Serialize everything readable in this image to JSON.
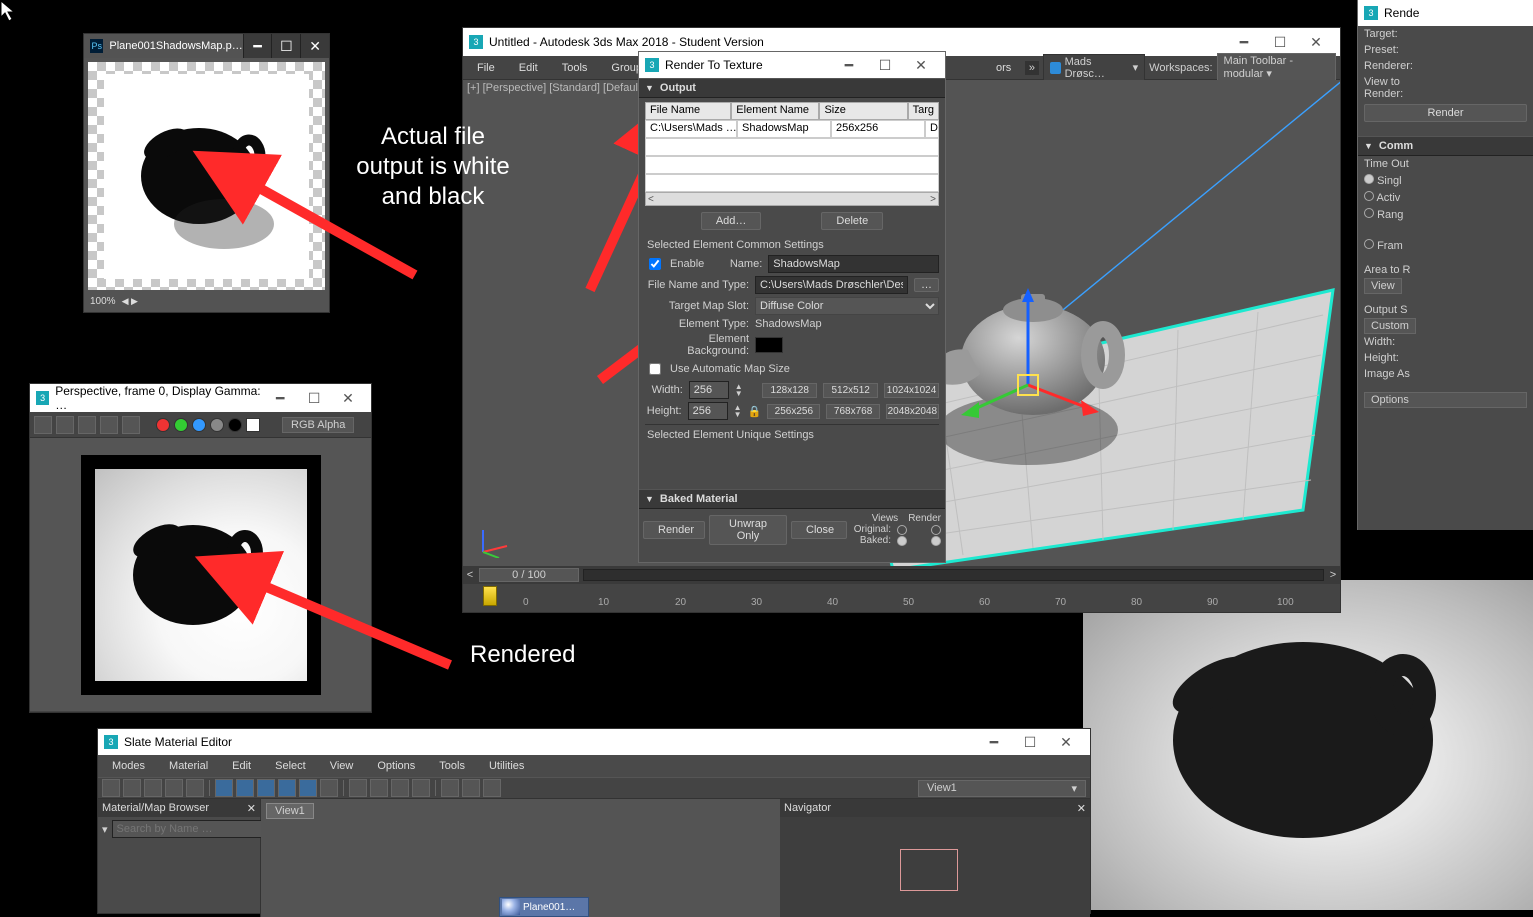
{
  "annotation": {
    "top": "Actual file\noutput is white\nand black",
    "bottom": "Rendered"
  },
  "photoshop": {
    "title": "Plane001ShadowsMap.p…",
    "zoom": "100%"
  },
  "framebuffer": {
    "title": "Perspective, frame 0, Display Gamma: …",
    "channel": "RGB Alpha"
  },
  "max": {
    "title": "Untitled - Autodesk 3ds Max 2018 - Student Version",
    "menu": [
      "File",
      "Edit",
      "Tools",
      "Group"
    ],
    "overflow_item": "ors",
    "user": "Mads Drøsc…",
    "workspaces_label": "Workspaces:",
    "workspace": "Main Toolbar - modular",
    "vp_label": "[+] [Perspective] [Standard] [Defaul",
    "frames": "0 / 100",
    "ticks": [
      "0",
      "10",
      "20",
      "30",
      "40",
      "50",
      "60",
      "70",
      "80",
      "90",
      "100"
    ]
  },
  "rtt": {
    "title": "Render To Texture",
    "output": "Output",
    "cols": {
      "fn": "File Name",
      "en": "Element Name",
      "sz": "Size",
      "tg": "Targ"
    },
    "row": {
      "fn": "C:\\Users\\Mads …",
      "en": "ShadowsMap",
      "sz": "256x256",
      "tg": "Diffu"
    },
    "add": "Add…",
    "delete": "Delete",
    "secs": "Selected Element Common Settings",
    "enable": "Enable",
    "name_lbl": "Name:",
    "name_val": "ShadowsMap",
    "file_lbl": "File Name and Type:",
    "file_val": "C:\\Users\\Mads Drøschler\\Desktop\\p",
    "slot_lbl": "Target Map Slot:",
    "slot_val": "Diffuse Color",
    "etype_lbl": "Element Type:",
    "etype_val": "ShadowsMap",
    "bg_lbl": "Element Background:",
    "auto": "Use Automatic Map Size",
    "width_lbl": "Width:",
    "width_val": "256",
    "height_lbl": "Height:",
    "height_val": "256",
    "w_btns": [
      "128x128",
      "512x512",
      "1024x1024"
    ],
    "h_btns": [
      "256x256",
      "768x768",
      "2048x2048"
    ],
    "seus": "Selected Element Unique Settings",
    "baked": "Baked Material",
    "render": "Render",
    "unwrap": "Unwrap Only",
    "close": "Close",
    "views": "Views",
    "render_col": "Render",
    "orig": "Original:",
    "bake": "Baked:"
  },
  "rs": {
    "title": "Rende",
    "target": "Target:",
    "preset": "Preset:",
    "renderer": "Renderer:",
    "view_to": "View to",
    "render": "Render:",
    "render_btn": "Render",
    "common": "Comm",
    "timeout": "Time Out",
    "single": "Singl",
    "active": "Activ",
    "range": "Rang",
    "frames": "Fram",
    "area": "Area to R",
    "view": "View",
    "outputs": "Output S",
    "custom": "Custom",
    "width": "Width:",
    "height": "Height:",
    "aspect": "Image As",
    "options": "Options"
  },
  "slate": {
    "title": "Slate Material Editor",
    "menu": [
      "Modes",
      "Material",
      "Edit",
      "Select",
      "View",
      "Options",
      "Tools",
      "Utilities"
    ],
    "browser": "Material/Map Browser",
    "search": "Search by Name …",
    "view_tab": "View1",
    "view_sel": "View1",
    "nav": "Navigator",
    "node": "Plane001…"
  }
}
